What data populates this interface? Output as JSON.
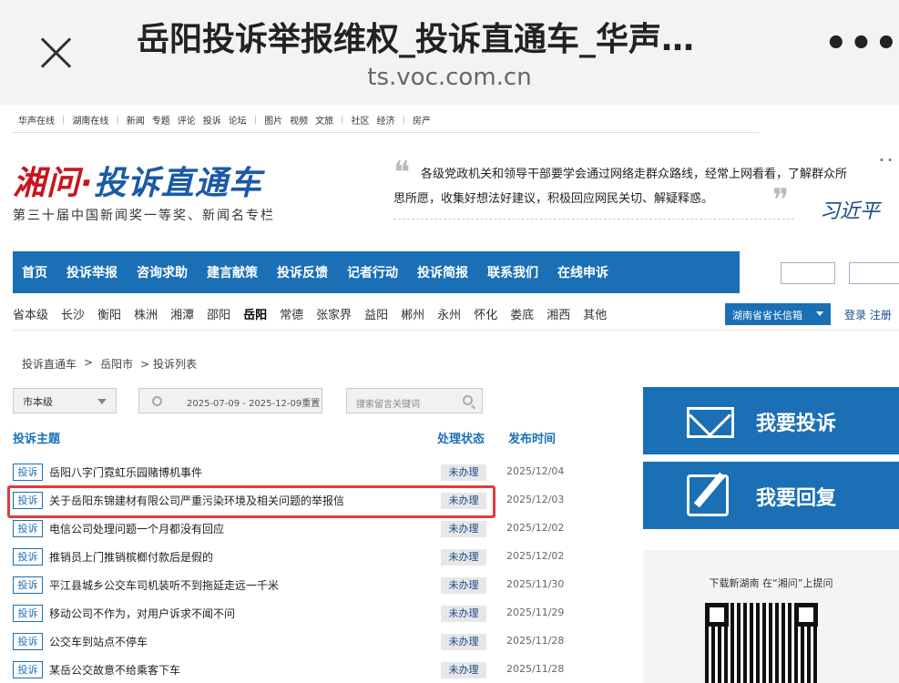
{
  "browser": {
    "title": "岳阳投诉举报维权_投诉直通车_华声…",
    "url": "ts.voc.com.cn",
    "more": "•••"
  },
  "top_nav": {
    "group1": [
      "华声在线",
      "湖南在线"
    ],
    "group2": [
      "新闻",
      "专题",
      "评论",
      "投诉",
      "论坛"
    ],
    "group3": [
      "图片",
      "视频",
      "文旅"
    ],
    "group4": [
      "社区",
      "经济"
    ],
    "group5": [
      "房产"
    ]
  },
  "banner": {
    "logo_red": "湘问·",
    "logo_blue": "投诉直通车",
    "logo_sub": "第三十届中国新闻奖一等奖、新闻名专栏",
    "quote": "各级党政机关和领导干部要学会通过网络走群众路线，经常上网看看，了解群众所思所愿，收集好想法好建议，积极回应网民关切、解疑释惑。",
    "quote_open": "❝",
    "quote_close": "❞",
    "signature": "习近平"
  },
  "main_nav": [
    "首页",
    "投诉举报",
    "咨询求助",
    "建言献策",
    "投诉反馈",
    "记者行动",
    "投诉简报",
    "联系我们",
    "在线申诉"
  ],
  "region_nav": [
    "省本级",
    "长沙",
    "衡阳",
    "株洲",
    "湘潭",
    "邵阳",
    "岳阳",
    "常德",
    "张家界",
    "益阳",
    "郴州",
    "永州",
    "怀化",
    "娄底",
    "湘西",
    "其他"
  ],
  "gov_select": "湖南省省长信箱",
  "login": "登录 注册",
  "breadcrumb": [
    "投诉直通车",
    ">",
    "岳阳市",
    "> 投诉列表"
  ],
  "filters": {
    "level": "市本级",
    "date_range": "2025-07-09 - 2025-12-09",
    "reset": "重置",
    "search_placeholder": "搜索留言关键词"
  },
  "table": {
    "headers": {
      "subject": "投诉主题",
      "status": "处理状态",
      "date": "发布时间"
    },
    "rows": [
      {
        "tag": "投诉",
        "title": "岳阳八字门霓虹乐园赌博机事件",
        "status": "未办理",
        "date": "2025/12/04"
      },
      {
        "tag": "投诉",
        "title": "关于岳阳东锦建材有限公司严重污染环境及相关问题的举报信",
        "status": "未办理",
        "date": "2025/12/03"
      },
      {
        "tag": "投诉",
        "title": "电信公司处理问题一个月都没有回应",
        "status": "未办理",
        "date": "2025/12/02"
      },
      {
        "tag": "投诉",
        "title": "推销员上门推销槟榔付款后是假的",
        "status": "未办理",
        "date": "2025/12/02"
      },
      {
        "tag": "投诉",
        "title": "平江县城乡公交车司机装听不到拖延走远一千米",
        "status": "未办理",
        "date": "2025/11/30"
      },
      {
        "tag": "投诉",
        "title": "移动公司不作为，对用户诉求不闻不问",
        "status": "未办理",
        "date": "2025/11/29"
      },
      {
        "tag": "投诉",
        "title": "公交车到站点不停车",
        "status": "未办理",
        "date": "2025/11/28"
      },
      {
        "tag": "投诉",
        "title": "某岳公交故意不给乘客下车",
        "status": "未办理",
        "date": "2025/11/28"
      }
    ]
  },
  "side": {
    "complain": "我要投诉",
    "reply": "我要回复",
    "qr_caption": "下载新湖南 在“湘问”上提问"
  }
}
